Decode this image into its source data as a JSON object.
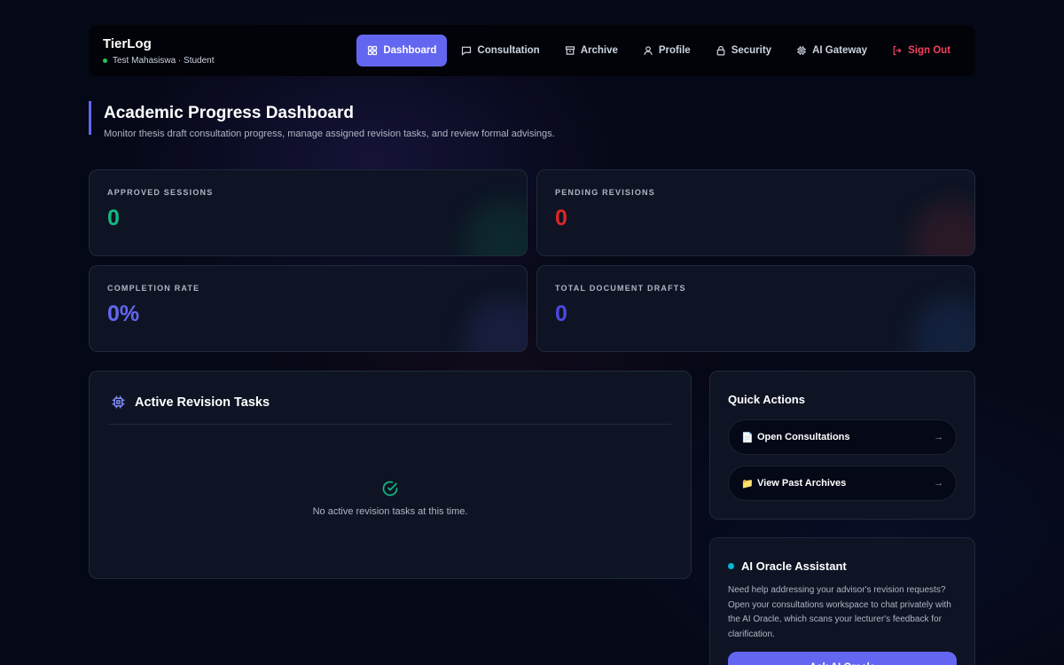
{
  "brand": {
    "title": "TierLog",
    "subtitle": "Test Mahasiswa · Student"
  },
  "nav": [
    {
      "label": "Dashboard",
      "icon": "grid-icon",
      "active": true
    },
    {
      "label": "Consultation",
      "icon": "chat-icon"
    },
    {
      "label": "Archive",
      "icon": "archive-icon"
    },
    {
      "label": "Profile",
      "icon": "user-icon"
    },
    {
      "label": "Security",
      "icon": "lock-icon"
    },
    {
      "label": "AI Gateway",
      "icon": "chip-icon"
    },
    {
      "label": "Sign Out",
      "icon": "sign-out-icon"
    }
  ],
  "header": {
    "title": "Academic Progress Dashboard",
    "subtitle": "Monitor thesis draft consultation progress, manage assigned revision tasks, and review formal advisings."
  },
  "stats": [
    {
      "label": "APPROVED SESSIONS",
      "value": "0",
      "color": "#10b981"
    },
    {
      "label": "PENDING REVISIONS",
      "value": "0",
      "color": "#dc2626"
    },
    {
      "label": "COMPLETION RATE",
      "value": "0%",
      "color": "#6366f1"
    },
    {
      "label": "TOTAL DOCUMENT DRAFTS",
      "value": "0",
      "color": "#4f46e5"
    }
  ],
  "tasks": {
    "title": "Active Revision Tasks",
    "empty_text": "No active revision tasks at this time."
  },
  "quick_actions": {
    "title": "Quick Actions",
    "items": [
      {
        "icon": "📄",
        "label": "Open Consultations",
        "arrow": "→"
      },
      {
        "icon": "📁",
        "label": "View Past Archives",
        "arrow": "→"
      }
    ]
  },
  "ai": {
    "title": "AI Oracle Assistant",
    "text": "Need help addressing your advisor's revision requests? Open your consultations workspace to chat privately with the AI Oracle, which scans your lecturer's feedback for clarification.",
    "button": "Ask AI Oracle"
  },
  "colors": {
    "accent": "#6366f1",
    "danger": "#f43f5e",
    "success": "#22c55e",
    "cyan": "#06b6d4"
  }
}
